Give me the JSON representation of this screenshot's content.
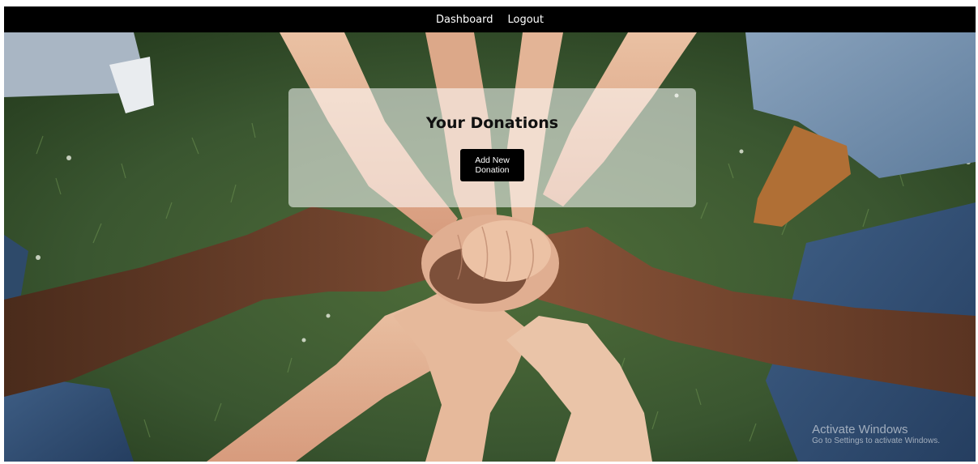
{
  "nav": {
    "links": [
      {
        "label": "Dashboard"
      },
      {
        "label": "Logout"
      }
    ]
  },
  "main": {
    "title": "Your Donations",
    "add_button_label": "Add New Donation"
  },
  "watermark": {
    "title": "Activate Windows",
    "subtitle": "Go to Settings to activate Windows."
  },
  "hero_image": {
    "description_icon": "hands-together-photo"
  },
  "colors": {
    "navbar": "#000000",
    "button": "#000000",
    "grass": "#33502a"
  }
}
